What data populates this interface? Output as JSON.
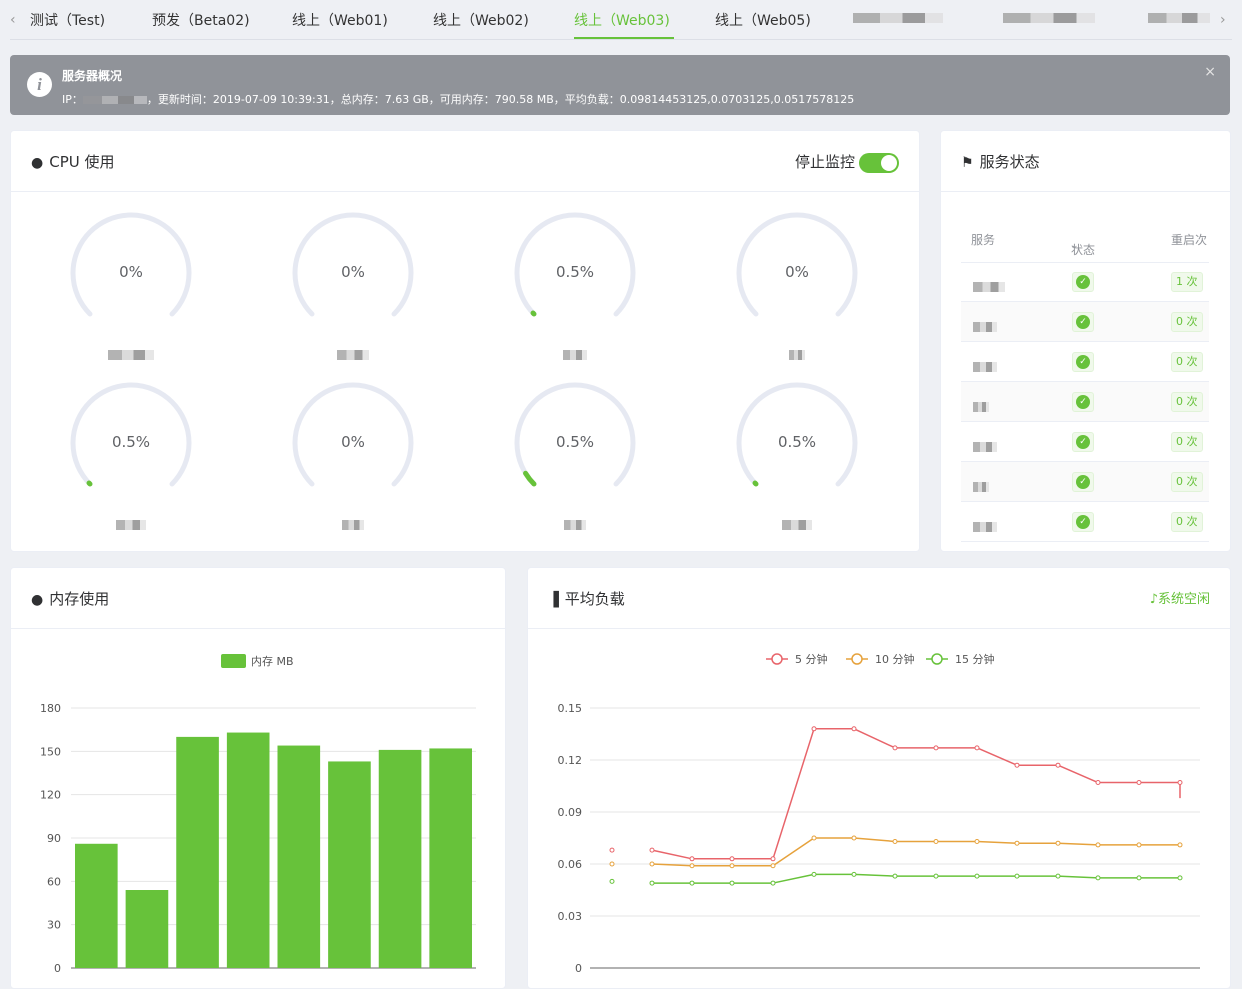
{
  "tabs": {
    "items": [
      {
        "label": "测试（Test)"
      },
      {
        "label": "预发（Beta02)"
      },
      {
        "label": "线上（Web01)"
      },
      {
        "label": "线上（Web02)"
      },
      {
        "label": "线上（Web03)",
        "active": true
      },
      {
        "label": "线上（Web05)"
      }
    ],
    "prev_icon": "chevron-left-icon",
    "next_icon": "chevron-right-icon"
  },
  "alert": {
    "title": "服务器概况",
    "ip_label": "IP：",
    "details": "，更新时间：2019-07-09 10:39:31，总内存：7.63 GB，可用内存：790.58 MB，平均负载：0.09814453125,0.0703125,0.0517578125",
    "close": "×"
  },
  "cpu": {
    "title": "CPU 使用",
    "switch_label": "停止监控",
    "switch_on": true,
    "gauges": [
      {
        "value": "0%",
        "percent": 0
      },
      {
        "value": "0%",
        "percent": 0
      },
      {
        "value": "0.5%",
        "percent": 0.5
      },
      {
        "value": "0%",
        "percent": 0
      },
      {
        "value": "0.5%",
        "percent": 0.5
      },
      {
        "value": "0%",
        "percent": 0
      },
      {
        "value": "0.5%",
        "percent": 0.5
      },
      {
        "value": "0.5%",
        "percent": 0.5
      }
    ]
  },
  "service": {
    "title": "服务状态",
    "col_service": "服务",
    "col_status": "状态",
    "col_restart": "重启次",
    "rows": [
      {
        "status": "ok",
        "restarts": "1 次"
      },
      {
        "status": "ok",
        "restarts": "0 次"
      },
      {
        "status": "ok",
        "restarts": "0 次"
      },
      {
        "status": "ok",
        "restarts": "0 次"
      },
      {
        "status": "ok",
        "restarts": "0 次"
      },
      {
        "status": "ok",
        "restarts": "0 次"
      },
      {
        "status": "ok",
        "restarts": "0 次"
      }
    ]
  },
  "memory": {
    "title": "内存使用",
    "chart_data": {
      "type": "bar",
      "legend": [
        "内存 MB"
      ],
      "ylim": [
        0,
        180
      ],
      "yticks": [
        0,
        30,
        60,
        90,
        120,
        150,
        180
      ],
      "values": [
        86,
        54,
        160,
        163,
        154,
        143,
        151,
        152
      ],
      "color": "#67c23a"
    }
  },
  "load": {
    "title": "平均负载",
    "status": "系统空闲",
    "chart_data": {
      "type": "line",
      "ylim": [
        0,
        0.15
      ],
      "yticks": [
        "0",
        "0.03",
        "0.06",
        "0.09",
        "0.12",
        "0.15"
      ],
      "series": [
        {
          "name": "5 分钟",
          "color": "#e8646a",
          "values": [
            0.068,
            0.068,
            0.063,
            0.063,
            0.063,
            0.138,
            0.138,
            0.127,
            0.127,
            0.127,
            0.117,
            0.117,
            0.107,
            0.107,
            0.107,
            0.098
          ]
        },
        {
          "name": "10 分钟",
          "color": "#e6a23c",
          "values": [
            0.06,
            0.06,
            0.059,
            0.059,
            0.059,
            0.075,
            0.075,
            0.073,
            0.073,
            0.073,
            0.072,
            0.072,
            0.071,
            0.071,
            0.071,
            0.071
          ]
        },
        {
          "name": "15 分钟",
          "color": "#67c23a",
          "values": [
            0.05,
            0.049,
            0.049,
            0.049,
            0.049,
            0.054,
            0.054,
            0.053,
            0.053,
            0.053,
            0.053,
            0.053,
            0.052,
            0.052,
            0.052,
            0.052
          ]
        }
      ]
    }
  }
}
